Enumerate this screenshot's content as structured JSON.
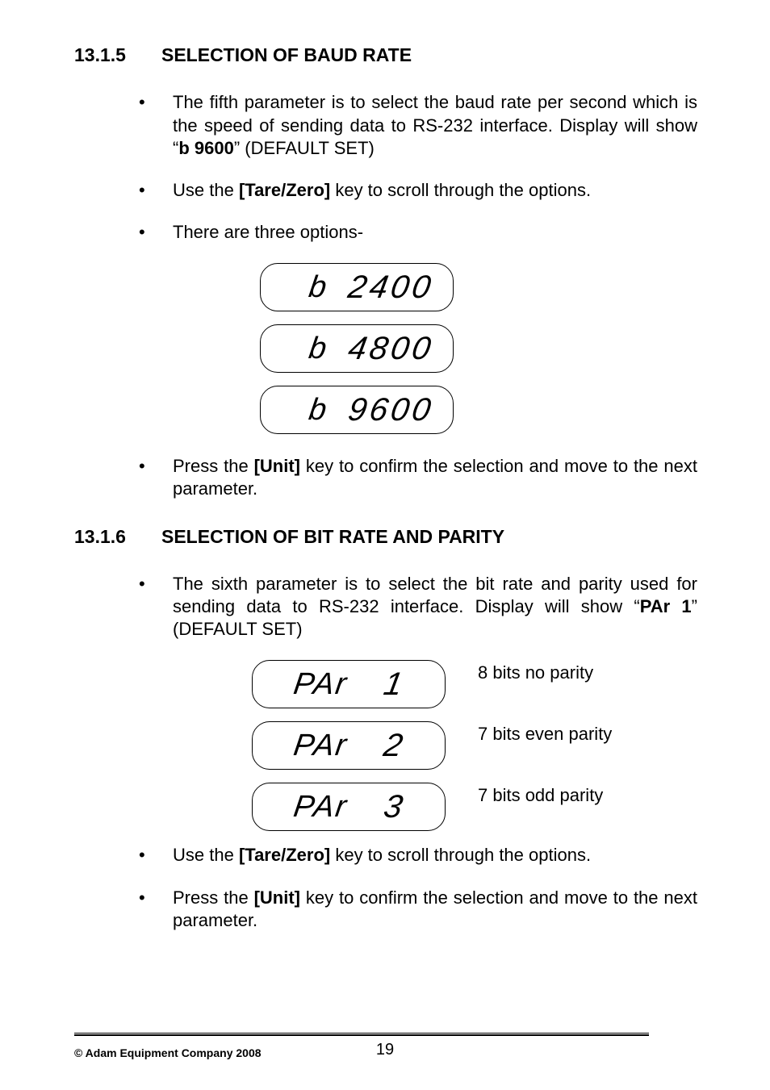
{
  "section1": {
    "num": "13.1.5",
    "title": "SELECTION OF BAUD RATE",
    "bullets": [
      {
        "pre": "The fifth parameter is to select the baud rate per second which is the speed of sending data to RS-232 interface. Display will show “",
        "bold": "b 9600",
        "post": "” (DEFAULT SET)"
      },
      {
        "pre": "Use the ",
        "bold": "[Tare/Zero]",
        "post": " key to scroll through the options."
      },
      {
        "pre": "There are three options-",
        "bold": "",
        "post": ""
      }
    ],
    "displays": [
      {
        "prefix": "b",
        "value": "2400"
      },
      {
        "prefix": "b",
        "value": "4800"
      },
      {
        "prefix": "b",
        "value": "9600"
      }
    ],
    "last": {
      "pre": "Press the ",
      "bold": "[Unit]",
      "post": " key to confirm the selection and move to the next parameter."
    }
  },
  "section2": {
    "num": "13.1.6",
    "title": "SELECTION OF BIT RATE AND PARITY",
    "bullet1": {
      "pre": "The sixth parameter is to select the bit rate and parity used for sending data to RS-232 interface. Display will show “",
      "bold": "PAr 1",
      "post": "” (DEFAULT SET)"
    },
    "displays": [
      {
        "prefix": "PAr",
        "value": "1",
        "label": "8 bits no parity"
      },
      {
        "prefix": "PAr",
        "value": "2",
        "label": "7 bits even parity"
      },
      {
        "prefix": "PAr",
        "value": "3",
        "label": "7 bits odd parity"
      }
    ],
    "bullet2": {
      "pre": "Use the ",
      "bold": "[Tare/Zero]",
      "post": " key to scroll through the options."
    },
    "bullet3": {
      "pre": "Press the ",
      "bold": "[Unit]",
      "post": " key to confirm the selection and move to the next parameter."
    }
  },
  "footer": {
    "copyright": "© Adam Equipment Company 2008",
    "page": "19"
  }
}
